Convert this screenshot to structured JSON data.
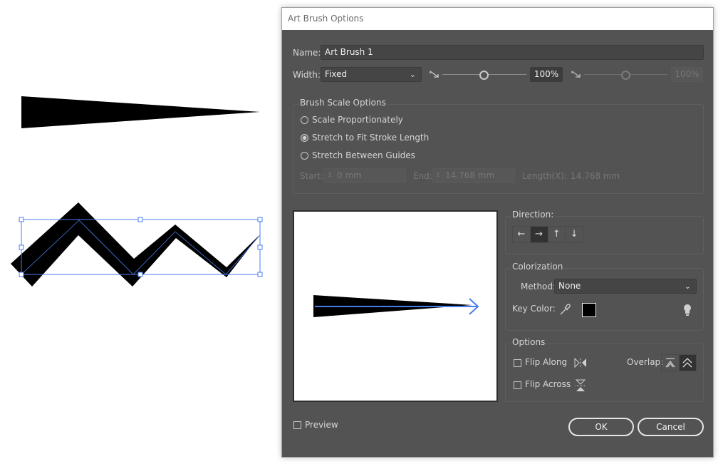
{
  "artboard": {
    "shapes": [
      {
        "name": "tapered-brush-stroke"
      },
      {
        "name": "zigzag-art-brush-path",
        "selected": true
      }
    ]
  },
  "dialog": {
    "title": "Art Brush Options",
    "name_label": "Name:",
    "name_value": "Art Brush 1",
    "width_label": "Width:",
    "width_option": "Fixed",
    "width_value": "100%",
    "width_value_max": "100%",
    "width_slider_fraction": 0.5,
    "scale_group": {
      "title": "Brush Scale Options",
      "options": [
        {
          "label": "Scale Proportionately",
          "selected": false
        },
        {
          "label": "Stretch to Fit Stroke Length",
          "selected": true
        },
        {
          "label": "Stretch Between Guides",
          "selected": false
        }
      ],
      "start_label": "Start:",
      "start_value": "0 mm",
      "end_label": "End:",
      "end_value": "14.768 mm",
      "length_label": "Length(X):",
      "length_value": "14.768 mm"
    },
    "direction": {
      "title": "Direction:",
      "buttons": [
        {
          "glyph": "←",
          "name": "left",
          "active": false
        },
        {
          "glyph": "→",
          "name": "right",
          "active": true
        },
        {
          "glyph": "↑",
          "name": "up",
          "active": false
        },
        {
          "glyph": "↓",
          "name": "down",
          "active": false
        }
      ]
    },
    "colorization": {
      "title": "Colorization",
      "method_label": "Method:",
      "method_value": "None",
      "key_color_label": "Key Color:",
      "key_color": "#000000"
    },
    "options": {
      "title": "Options",
      "flip_along_label": "Flip Along",
      "flip_along_checked": false,
      "flip_across_label": "Flip Across",
      "flip_across_checked": false,
      "overlap_label": "Overlap:"
    },
    "preview_label": "Preview",
    "preview_checked": false,
    "ok_label": "OK",
    "cancel_label": "Cancel"
  },
  "colors": {
    "dialog_bg": "#535353",
    "selection": "#4a7cf0",
    "path_stroke": "#000000"
  }
}
